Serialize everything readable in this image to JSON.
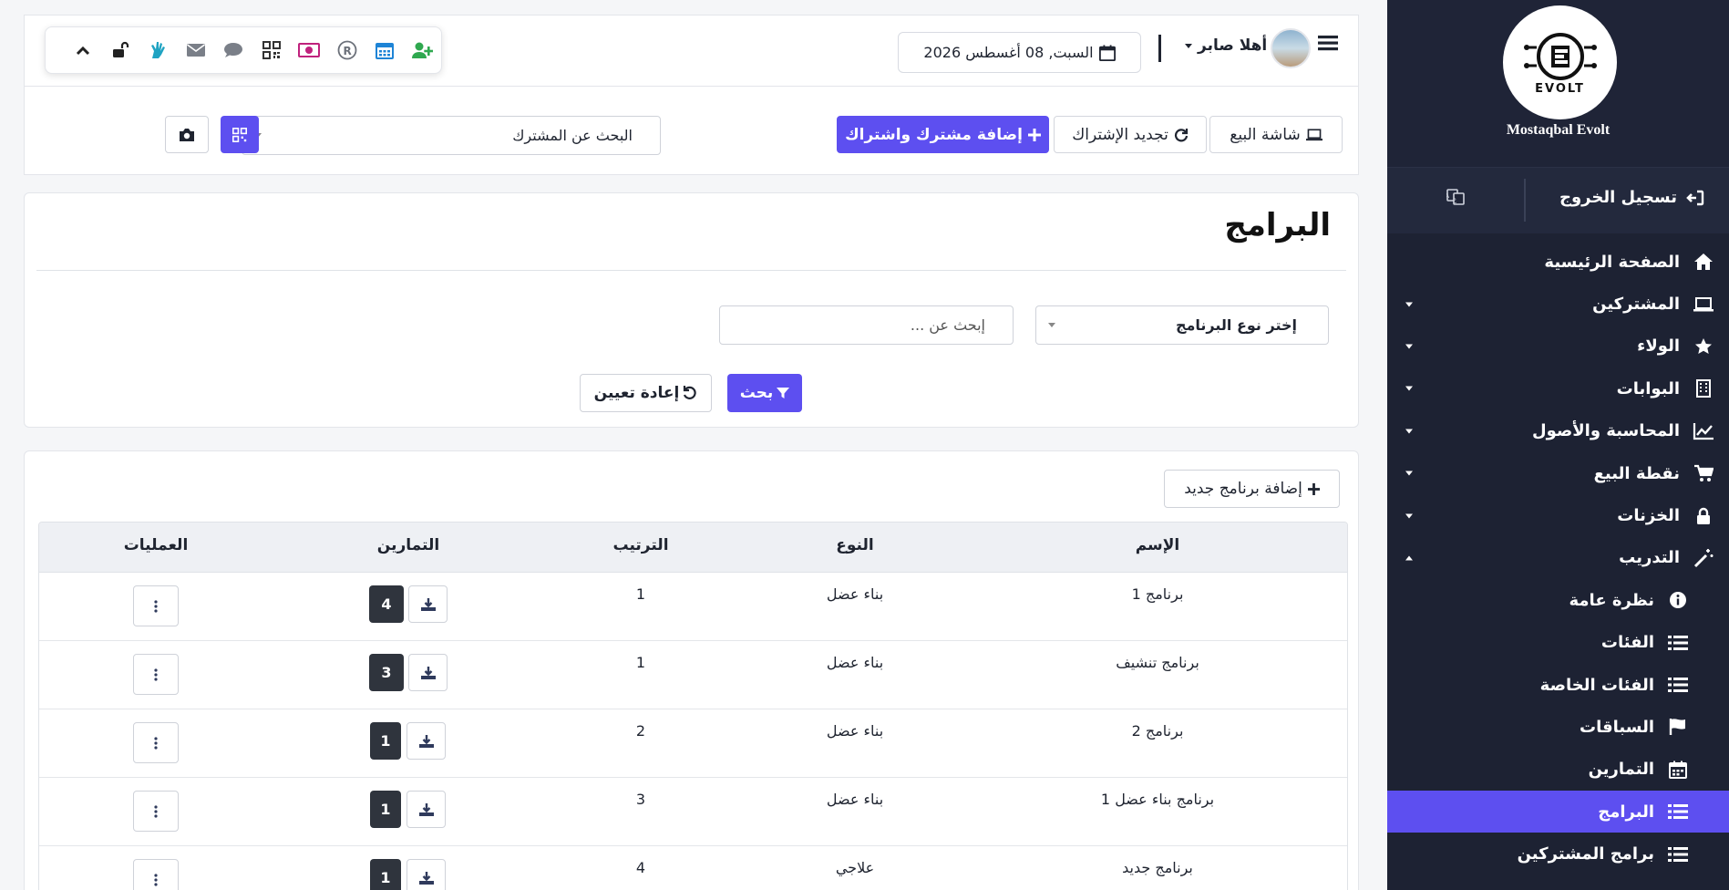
{
  "sidebar": {
    "brand": "Mostaqbal Evolt",
    "logo_text": "EVOLT",
    "logout_label": "تسجيل الخروج",
    "items": [
      {
        "label": "الصفحة الرئيسية",
        "icon": "home-icon"
      },
      {
        "label": "المشتركين",
        "icon": "laptop-icon"
      },
      {
        "label": "الولاء",
        "icon": "star-icon"
      },
      {
        "label": "البوابات",
        "icon": "building-icon"
      },
      {
        "label": "المحاسبة والأصول",
        "icon": "chart-line-icon"
      },
      {
        "label": "نقطة البيع",
        "icon": "cart-icon"
      },
      {
        "label": "الخزنات",
        "icon": "lock-icon"
      },
      {
        "label": "التدريب",
        "icon": "magic-wand-icon"
      },
      {
        "label": "نظرة عامة",
        "icon": "info-icon"
      },
      {
        "label": "الفئات",
        "icon": "list-icon"
      },
      {
        "label": "الفئات الخاصة",
        "icon": "list-icon"
      },
      {
        "label": "السباقات",
        "icon": "flag-icon"
      },
      {
        "label": "التمارين",
        "icon": "calendar-icon"
      },
      {
        "label": "البرامج",
        "icon": "list-icon"
      },
      {
        "label": "برامج المشتركين",
        "icon": "list-icon"
      }
    ]
  },
  "header": {
    "greeting": "أهلا صابر",
    "date": "السبت, 08 أغسطس 2026",
    "sell_screen": "شاشة البيع",
    "renew": "تجديد الإشتراك",
    "add_member": "إضافة مشترك واشتراك",
    "search_member": "البحث عن المشترك"
  },
  "filter": {
    "title": "البرامج",
    "program_type": "إختر نوع البرنامج",
    "search_placeholder": "إبحث عن ...",
    "search_btn": "بحث",
    "reset_btn": "إعادة تعيين"
  },
  "table": {
    "add_btn": "إضافة برنامج جديد",
    "headers": {
      "name": "الإسم",
      "type": "النوع",
      "order": "الترتيب",
      "exercises": "التمارين",
      "ops": "العمليات"
    },
    "rows": [
      {
        "name": "برنامج 1",
        "type": "بناء عضل",
        "order": "1",
        "count": "4"
      },
      {
        "name": "برنامج تنشيف",
        "type": "بناء عضل",
        "order": "1",
        "count": "3"
      },
      {
        "name": "برنامج 2",
        "type": "بناء عضل",
        "order": "2",
        "count": "1"
      },
      {
        "name": "برنامج بناء عضل 1",
        "type": "بناء عضل",
        "order": "3",
        "count": "1"
      },
      {
        "name": "برنامج جديد",
        "type": "علاجي",
        "order": "4",
        "count": "1"
      }
    ]
  },
  "colors": {
    "accent": "#5d4ff0",
    "sidebar_bg": "#1d2233",
    "dark_badge": "#2f343d"
  }
}
